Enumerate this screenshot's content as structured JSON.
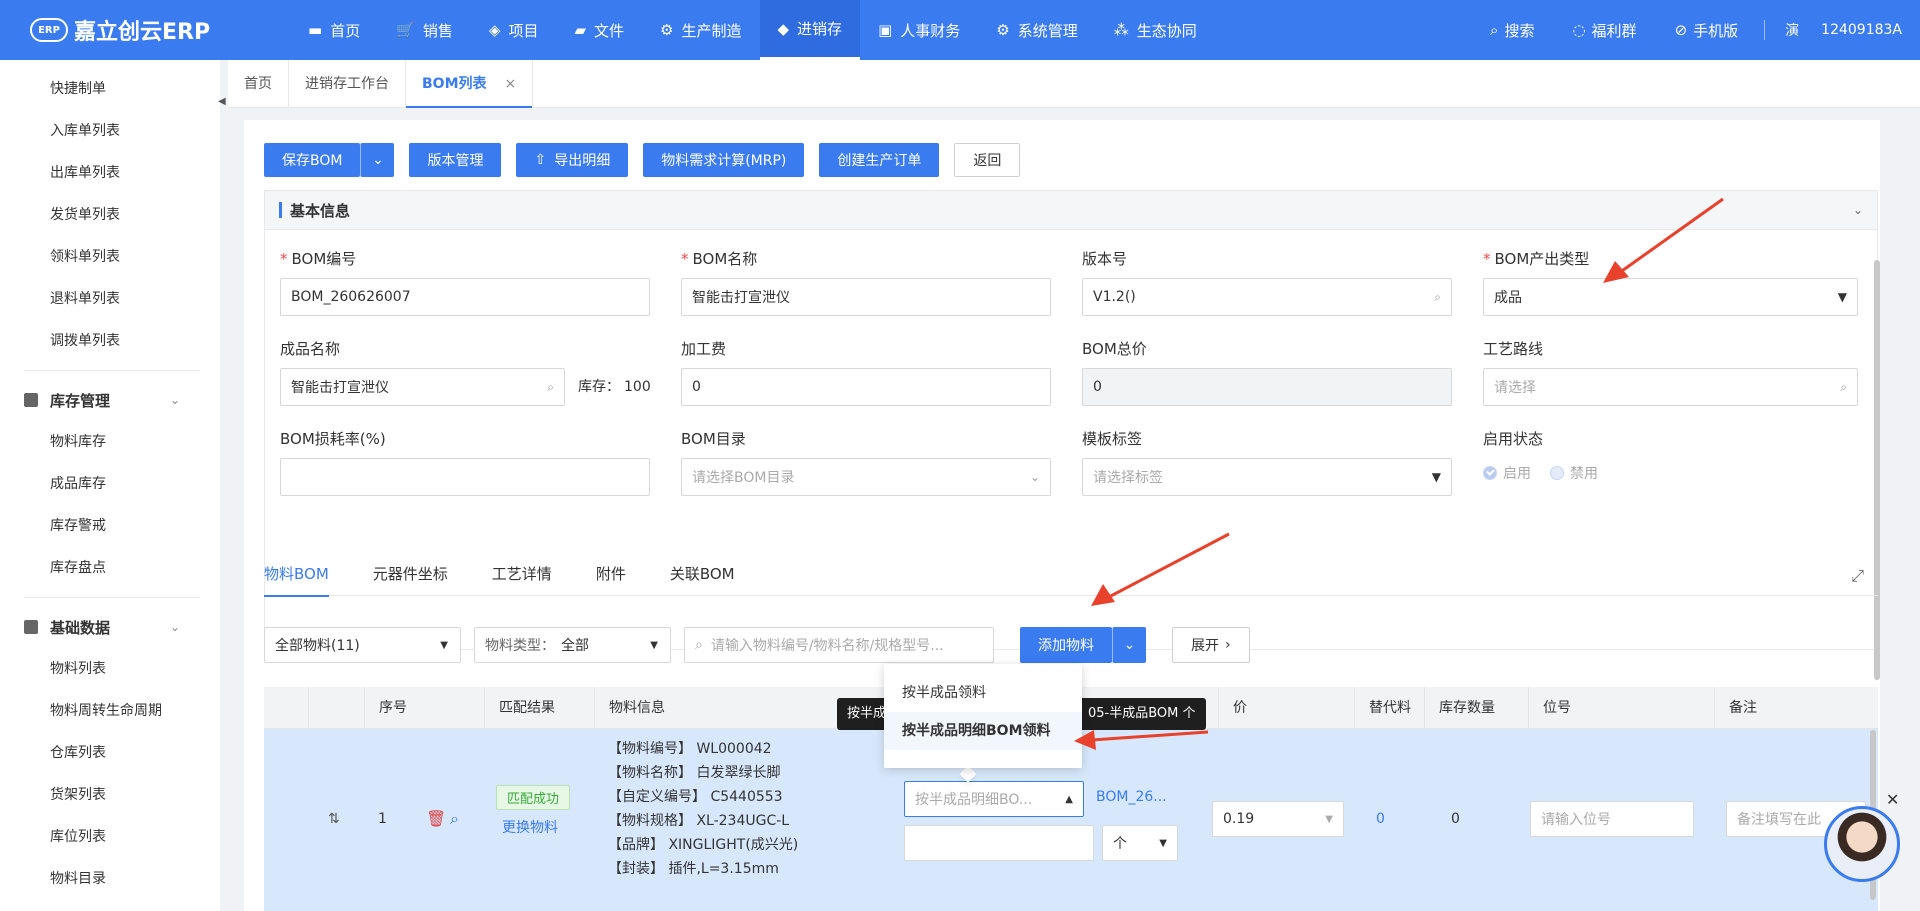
{
  "app": {
    "logo_mark": "ERP",
    "title": "嘉立创云ERP"
  },
  "topnav": [
    {
      "icon": "monitor-icon",
      "glyph": "▬",
      "label": "首页"
    },
    {
      "icon": "cart-icon",
      "glyph": "🛒",
      "label": "销售"
    },
    {
      "icon": "layers-icon",
      "glyph": "◈",
      "label": "项目"
    },
    {
      "icon": "folder-icon",
      "glyph": "▰",
      "label": "文件"
    },
    {
      "icon": "gear-icon",
      "glyph": "⚙",
      "label": "生产制造"
    },
    {
      "icon": "cube-icon",
      "glyph": "◆",
      "label": "进销存",
      "active": true
    },
    {
      "icon": "person-card-icon",
      "glyph": "▣",
      "label": "人事财务"
    },
    {
      "icon": "settings-icon",
      "glyph": "⚙",
      "label": "系统管理"
    },
    {
      "icon": "ecosystem-icon",
      "glyph": "⁂",
      "label": "生态协同"
    }
  ],
  "topright": {
    "search": "搜索",
    "welfare": "福利群",
    "mobile": "手机版",
    "user_badge": "演",
    "user_id": "12409183A"
  },
  "sidebar": {
    "items_top": [
      "快捷制单",
      "入库单列表",
      "出库单列表",
      "发货单列表",
      "领料单列表",
      "退料单列表",
      "调拨单列表"
    ],
    "group1": {
      "label": "库存管理",
      "items": [
        "物料库存",
        "成品库存",
        "库存警戒",
        "库存盘点"
      ]
    },
    "group2": {
      "label": "基础数据",
      "items": [
        "物料列表",
        "物料周转生命周期",
        "仓库列表",
        "货架列表",
        "库位列表",
        "物料目录"
      ]
    }
  },
  "tabs": [
    {
      "label": "首页"
    },
    {
      "label": "进销存工作台"
    },
    {
      "label": "BOM列表",
      "active": true,
      "close": "×"
    }
  ],
  "toolbar": {
    "save_bom": "保存BOM",
    "version_mgmt": "版本管理",
    "export_detail": "导出明细",
    "mrp": "物料需求计算(MRP)",
    "create_order": "创建生产订单",
    "back": "返回"
  },
  "basic_info": {
    "title": "基本信息",
    "bom_no_label": "BOM编号",
    "bom_no": "BOM_260626007",
    "bom_name_label": "BOM名称",
    "bom_name": "智能击打宣泄仪",
    "version_label": "版本号",
    "version": "V1.2()",
    "output_type_label": "BOM产出类型",
    "output_type": "成品",
    "product_name_label": "成品名称",
    "product_name": "智能击打宣泄仪",
    "stock_label": "库存：",
    "stock_value": "100",
    "processing_fee_label": "加工费",
    "processing_fee": "0",
    "total_price_label": "BOM总价",
    "total_price": "0",
    "route_label": "工艺路线",
    "route_placeholder": "请选择",
    "loss_rate_label": "BOM损耗率(%)",
    "loss_rate": "",
    "catalog_label": "BOM目录",
    "catalog_placeholder": "请选择BOM目录",
    "template_label": "模板标签",
    "template_placeholder": "请选择标签",
    "status_label": "启用状态",
    "status_on": "启用",
    "status_off": "禁用"
  },
  "subtabs": [
    "物料BOM",
    "元器件坐标",
    "工艺详情",
    "附件",
    "关联BOM"
  ],
  "filters": {
    "all_materials": "全部物料(11)",
    "type_label": "物料类型：",
    "type_value": "全部",
    "search_placeholder": "请输入物料编号/物料名称/规格型号...",
    "add_material": "添加物料",
    "expand": "展开"
  },
  "table": {
    "headers": {
      "seq": "序号",
      "match": "匹配结果",
      "info": "物料信息",
      "price": "价",
      "substitute": "替代料",
      "stock_qty": "库存数量",
      "position": "位号",
      "remark": "备注"
    },
    "row": {
      "seq": "1",
      "match_status": "匹配成功",
      "replace": "更换物料",
      "info_lines": [
        "【物料编号】 WL000042",
        "【物料名称】 白发翠绿长脚",
        "【自定义编号】 C5440553",
        "【物料规格】 XL-234UGC-L",
        "【品牌】 XINGLIGHT(成兴光)",
        "【封装】 插件,L=3.15mm"
      ],
      "pick_mode": "按半成品明细BO...",
      "bom_link": "BOM_26...",
      "unit": "个",
      "price": "0.19",
      "substitute": "0",
      "stock_qty": "0",
      "position_placeholder": "请输入位号",
      "remark_placeholder": "备注填写在此"
    }
  },
  "dropdown": {
    "items": [
      "按半成品领料",
      "按半成品明细BOM领料"
    ],
    "tooltip_left": "按半成",
    "tooltip_right": "05-半成品BOM 个"
  },
  "colors": {
    "primary": "#3a7bf0",
    "arrow": "#e8412c",
    "success": "#3aab3a"
  }
}
